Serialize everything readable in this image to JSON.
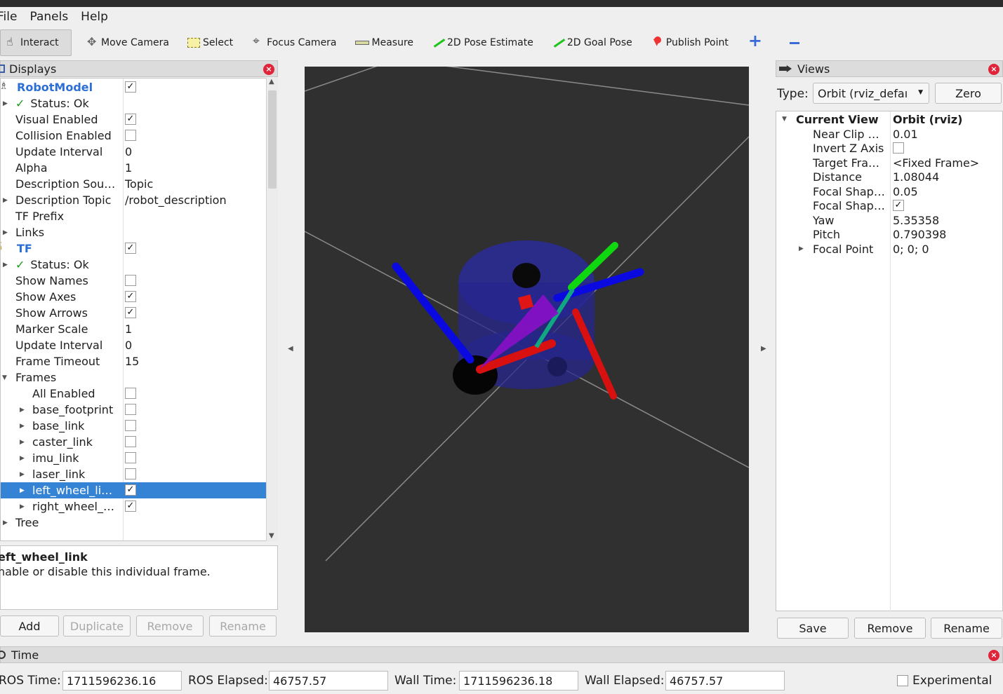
{
  "menu": [
    "File",
    "Panels",
    "Help"
  ],
  "toolbar": {
    "interact": "Interact",
    "move_camera": "Move Camera",
    "select": "Select",
    "focus_camera": "Focus Camera",
    "measure": "Measure",
    "pose_estimate": "2D Pose Estimate",
    "goal_pose": "2D Goal Pose",
    "publish_point": "Publish Point"
  },
  "displays": {
    "title": "Displays",
    "rows": [
      {
        "name": "RobotModel",
        "check": "✓"
      },
      {
        "name": "Status: Ok"
      },
      {
        "name": "Visual Enabled",
        "check": "✓"
      },
      {
        "name": "Collision Enabled",
        "check": ""
      },
      {
        "name": "Update Interval",
        "value": "0"
      },
      {
        "name": "Alpha",
        "value": "1"
      },
      {
        "name": "Description Sou…",
        "value": "Topic"
      },
      {
        "name": "Description Topic",
        "value": "/robot_description"
      },
      {
        "name": "TF Prefix"
      },
      {
        "name": "Links"
      },
      {
        "name": "TF",
        "check": "✓"
      },
      {
        "name": "Status: Ok"
      },
      {
        "name": "Show Names",
        "check": ""
      },
      {
        "name": "Show Axes",
        "check": "✓"
      },
      {
        "name": "Show Arrows",
        "check": "✓"
      },
      {
        "name": "Marker Scale",
        "value": "1"
      },
      {
        "name": "Update Interval",
        "value": "0"
      },
      {
        "name": "Frame Timeout",
        "value": "15"
      },
      {
        "name": "Frames"
      },
      {
        "name": "All Enabled",
        "check": ""
      },
      {
        "name": "base_footprint",
        "check": ""
      },
      {
        "name": "base_link",
        "check": ""
      },
      {
        "name": "caster_link",
        "check": ""
      },
      {
        "name": "imu_link",
        "check": ""
      },
      {
        "name": "laser_link",
        "check": ""
      },
      {
        "name": "left_wheel_li…",
        "check": "✓"
      },
      {
        "name": "right_wheel_…",
        "check": "✓"
      },
      {
        "name": "Tree"
      }
    ],
    "status_mark": "✓"
  },
  "description": {
    "title": "eft_wheel_link",
    "text": "nable or disable this individual frame."
  },
  "buttons": {
    "add": "Add",
    "duplicate": "Duplicate",
    "remove": "Remove",
    "rename": "Rename"
  },
  "views": {
    "title": "Views",
    "type_label": "Type:",
    "type_value": "Orbit (rviz_defaı",
    "zero": "Zero",
    "rows": [
      {
        "name": "Current View",
        "value": "Orbit (rviz)"
      },
      {
        "name": "Near Clip …",
        "value": "0.01"
      },
      {
        "name": "Invert Z Axis",
        "check": ""
      },
      {
        "name": "Target Fra…",
        "value": "<Fixed Frame>"
      },
      {
        "name": "Distance",
        "value": "1.08044"
      },
      {
        "name": "Focal Shap…",
        "value": "0.05"
      },
      {
        "name": "Focal Shap…",
        "check": "✓"
      },
      {
        "name": "Yaw",
        "value": "5.35358"
      },
      {
        "name": "Pitch",
        "value": "0.790398"
      },
      {
        "name": "Focal Point",
        "value": "0; 0; 0"
      }
    ],
    "save": "Save",
    "remove": "Remove",
    "rename": "Rename"
  },
  "time": {
    "title": "Time",
    "ros_time_label": "ROS Time:",
    "ros_time": "1711596236.16",
    "ros_elapsed_label": "ROS Elapsed:",
    "ros_elapsed": "46757.57",
    "wall_time_label": "Wall Time:",
    "wall_time": "1711596236.18",
    "wall_elapsed_label": "Wall Elapsed:",
    "wall_elapsed": "46757.57",
    "experimental": "Experimental"
  },
  "colors": {
    "selection": "#3583d4",
    "viewport_bg": "#303030",
    "link_blue": "#2c6fd6"
  }
}
